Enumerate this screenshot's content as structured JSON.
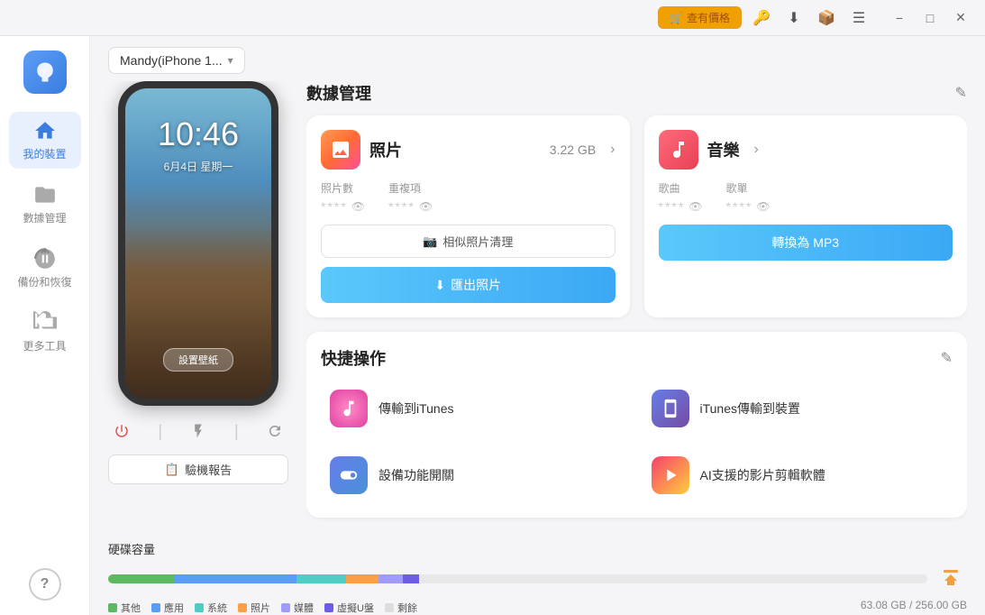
{
  "titlebar": {
    "price_btn": "查有價格",
    "icons": [
      "key",
      "download",
      "box",
      "menu",
      "minimize",
      "maximize",
      "close"
    ]
  },
  "sidebar": {
    "logo_alt": "App Logo",
    "items": [
      {
        "id": "my-device",
        "label": "我的裝置",
        "active": true
      },
      {
        "id": "data-manage",
        "label": "數據管理",
        "active": false
      },
      {
        "id": "backup-restore",
        "label": "備份和恢復",
        "active": false
      },
      {
        "id": "more-tools",
        "label": "更多工具",
        "active": false
      }
    ],
    "help_label": "?"
  },
  "device": {
    "name": "Mandy(iPhone 1...",
    "chevron": "▾",
    "phone": {
      "time": "10:46",
      "date": "6月4日 星期一",
      "wallpaper_btn": "設置壁紙"
    },
    "controls": {
      "power": "⏻",
      "flash": "✱",
      "refresh": "↻"
    },
    "diagnostics_btn": "驗機報告"
  },
  "storage": {
    "label": "硬碟容量",
    "segments": [
      {
        "color": "#5db860",
        "pct": 8,
        "label": "其他"
      },
      {
        "color": "#5b9cf6",
        "pct": 15,
        "label": "應用"
      },
      {
        "color": "#4ecdc4",
        "pct": 6,
        "label": "系統"
      },
      {
        "color": "#ff9f43",
        "pct": 4,
        "label": "照片"
      },
      {
        "color": "#a29bfe",
        "pct": 3,
        "label": "媒體"
      },
      {
        "color": "#6c5ce7",
        "pct": 2,
        "label": "虛擬U盤"
      },
      {
        "color": "#ddd",
        "pct": 62,
        "label": "剩餘"
      }
    ],
    "used": "63.08 GB / 256.00 GB",
    "clean_icon": "🧹"
  },
  "data_management": {
    "title": "數據管理",
    "edit_icon": "✎",
    "photos_card": {
      "title": "照片",
      "size": "3.22 GB",
      "icon": "🖼",
      "stats": [
        {
          "label": "照片數",
          "value": "****"
        },
        {
          "label": "重複項",
          "value": "****"
        }
      ],
      "secondary_action": "相似照片清理",
      "primary_action": "匯出照片",
      "camera_icon": "📷",
      "download_icon": "⬇"
    },
    "music_card": {
      "title": "音樂",
      "icon": "♫",
      "stats": [
        {
          "label": "歌曲",
          "value": "****"
        },
        {
          "label": "歌單",
          "value": "****"
        }
      ],
      "primary_action": "轉換為 MP3"
    }
  },
  "quick_actions": {
    "title": "快捷操作",
    "edit_icon": "✎",
    "items": [
      {
        "id": "send-itunes",
        "label": "傳輸到iTunes",
        "icon_type": "itunes"
      },
      {
        "id": "itunes-to-device",
        "label": "iTunes傳輸到裝置",
        "icon_type": "itunes-device"
      },
      {
        "id": "device-toggle",
        "label": "設備功能開關",
        "icon_type": "settings"
      },
      {
        "id": "ai-video",
        "label": "AI支援的影片剪輯軟體",
        "icon_type": "ai-video"
      }
    ]
  }
}
